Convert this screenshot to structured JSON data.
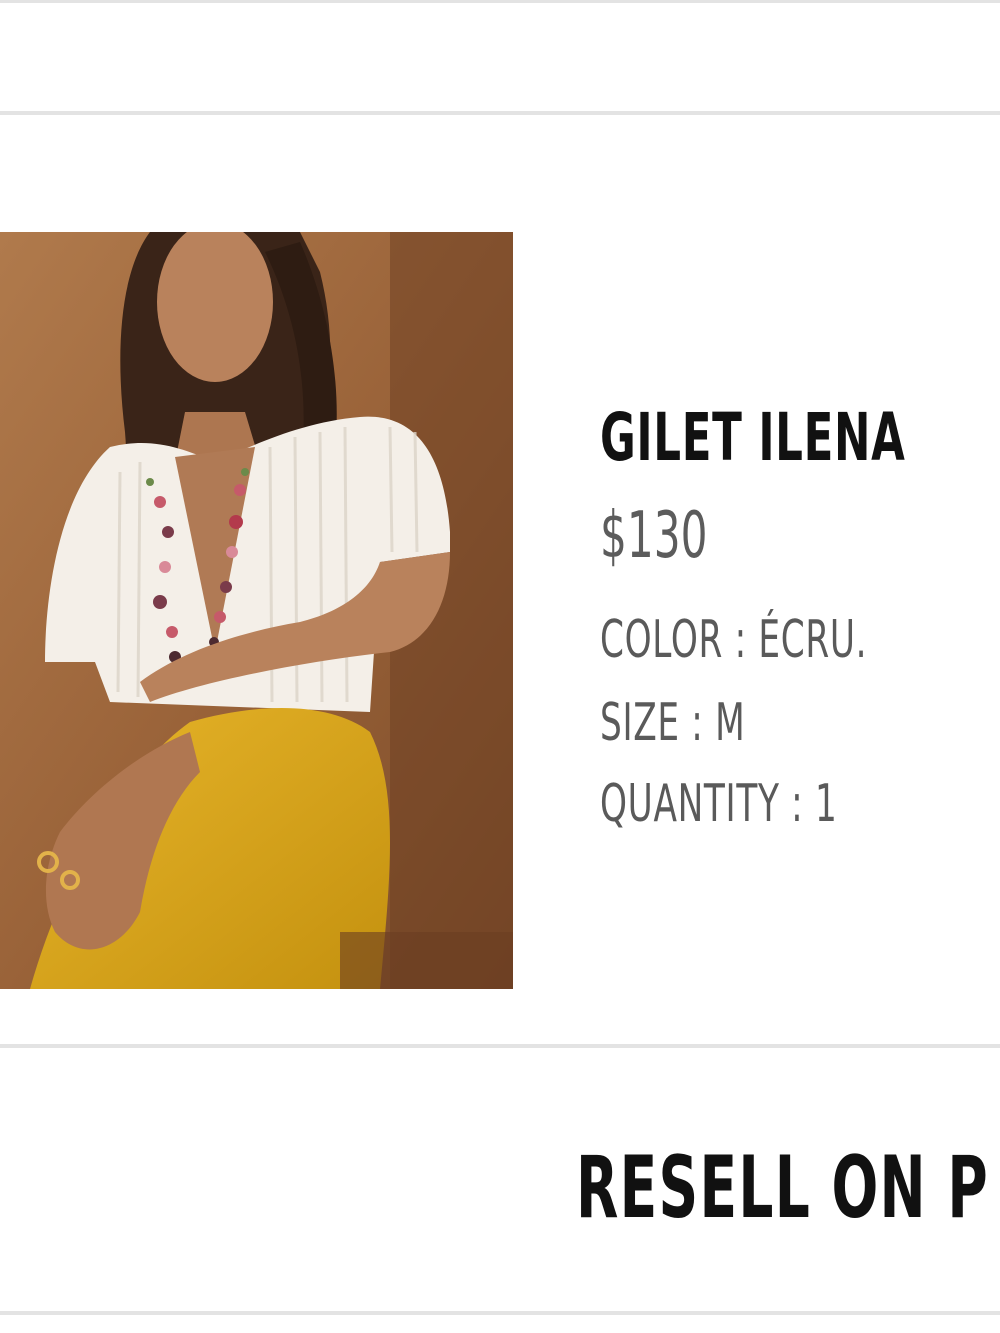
{
  "product": {
    "name": "GILET ILENA",
    "price": "$130",
    "color_line": "COLOR : ÉCRU.",
    "size_line": "SIZE : M",
    "quantity_line": "QUANTITY : 1",
    "image_description": "product-photo"
  },
  "actions": {
    "resell_label": "RESELL ON P"
  },
  "colors": {
    "divider": "#e3e3e3",
    "title_text": "#111111",
    "secondary_text": "#5c5c5c"
  }
}
